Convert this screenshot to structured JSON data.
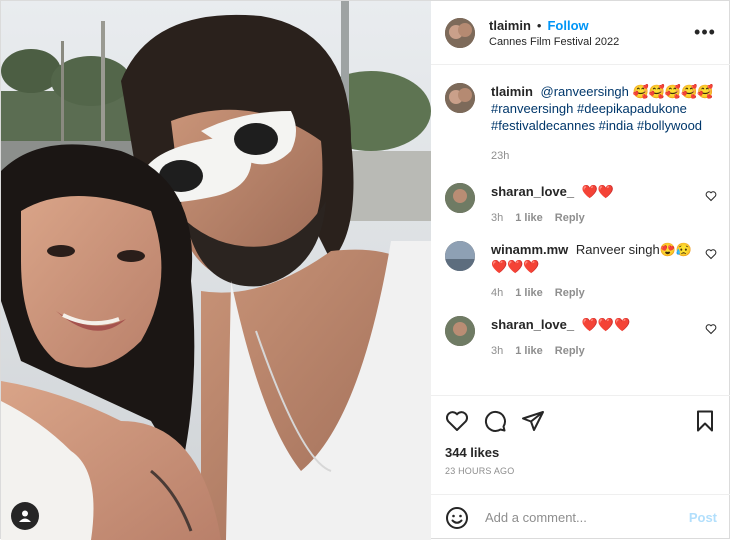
{
  "header": {
    "username": "tlaimin",
    "separator": "•",
    "follow_label": "Follow",
    "location": "Cannes Film Festival 2022",
    "more_icon": "ellipsis-icon"
  },
  "caption": {
    "username": "tlaimin",
    "mention": "@ranveersingh",
    "emojis": "🥰🥰🥰🥰🥰",
    "hashtags": "#ranveersingh #deepikapadukone #festivaldecannes #india #bollywood",
    "time": "23h"
  },
  "comments": [
    {
      "username": "sharan_love_",
      "text": "",
      "hearts": "❤️❤️",
      "time": "3h",
      "likes": "1 like",
      "reply": "Reply"
    },
    {
      "username": "winamm.mw",
      "text": "Ranveer singh😍😥",
      "hearts": "❤️❤️❤️",
      "time": "4h",
      "likes": "1 like",
      "reply": "Reply"
    },
    {
      "username": "sharan_love_",
      "text": "",
      "hearts": "❤️❤️❤️",
      "time": "3h",
      "likes": "1 like",
      "reply": "Reply"
    }
  ],
  "actions": {
    "like_icon": "heart-icon",
    "comment_icon": "comment-icon",
    "share_icon": "send-icon",
    "save_icon": "bookmark-icon"
  },
  "likes": "344 likes",
  "posted": "23 HOURS AGO",
  "add_comment": {
    "placeholder": "Add a comment...",
    "post_label": "Post",
    "emoji_icon": "smiley-icon"
  },
  "colors": {
    "accent": "#0095f6",
    "post_disabled": "#b2dffc",
    "heart_red": "#ed1c24"
  }
}
